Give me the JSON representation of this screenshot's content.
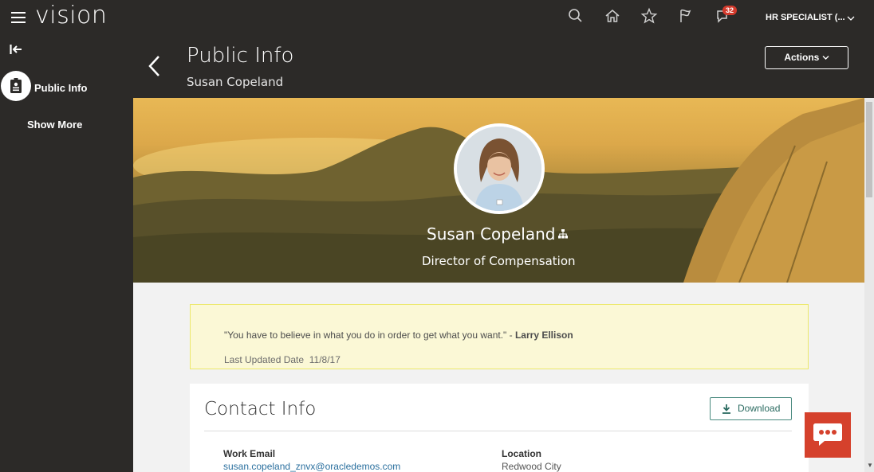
{
  "app": {
    "logo": "vision",
    "notification_count": "32",
    "role": "HR SPECIALIST (..."
  },
  "icons": [
    "hamburger-icon",
    "search-icon",
    "home-icon",
    "star-icon",
    "flag-icon",
    "notifications-icon",
    "chevron-down-icon",
    "collapse-panel-icon",
    "public-info-icon",
    "back-arrow-icon",
    "org-chart-icon",
    "download-icon",
    "chat-icon"
  ],
  "sidebar": {
    "items": [
      {
        "label": "Public Info"
      }
    ],
    "show_more": "Show More"
  },
  "header": {
    "title": "Public Info",
    "subtitle": "Susan Copeland",
    "actions_label": "Actions"
  },
  "profile": {
    "name": "Susan Copeland",
    "job_title": "Director of Compensation"
  },
  "quote": {
    "text": "\"You have to believe in what you do in order to get what you want.\" - ",
    "author": "Larry Ellison",
    "updated_label": "Last Updated Date",
    "updated_date": "11/8/17"
  },
  "contact": {
    "title": "Contact Info",
    "download_label": "Download",
    "fields": [
      {
        "label": "Work Email",
        "value": "susan.copeland_znvx@oracledemos.com"
      },
      {
        "label": "Location",
        "value": "Redwood City"
      }
    ]
  },
  "colors": {
    "topbar": "#2c2a28",
    "chat": "#d5412c",
    "quote_bg": "#fbf8d6",
    "link": "#2a6f9e"
  }
}
